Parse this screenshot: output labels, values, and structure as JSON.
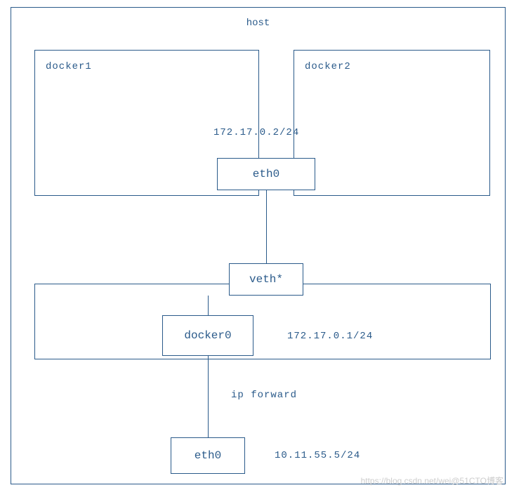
{
  "host_label": "host",
  "docker1_label": "docker1",
  "docker2_label": "docker2",
  "eth0_top": "eth0",
  "ip_top": "172.17.0.2/24",
  "veth": "veth*",
  "docker0": "docker0",
  "ip_docker0": "172.17.0.1/24",
  "ip_forward": "ip forward",
  "eth0_bottom": "eth0",
  "ip_eth0_bottom": "10.11.55.5/24",
  "watermark_left": "https://blog.csdn.net/wei",
  "watermark_right": "@51CTO博客"
}
